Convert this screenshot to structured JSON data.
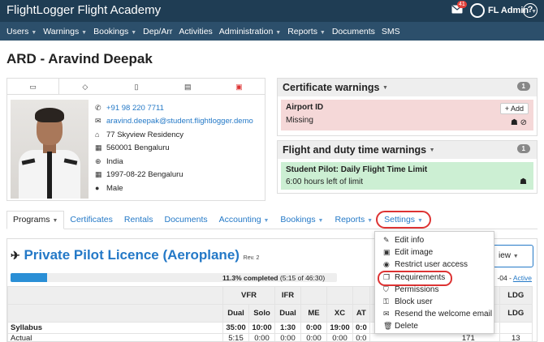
{
  "topbar": {
    "brand": "FlightLogger Flight Academy",
    "mail_count": "41",
    "user": "FL Admin",
    "help": "?"
  },
  "nav": [
    {
      "label": "Users",
      "caret": true
    },
    {
      "label": "Warnings",
      "caret": true
    },
    {
      "label": "Bookings",
      "caret": true
    },
    {
      "label": "Dep/Arr",
      "caret": false
    },
    {
      "label": "Activities",
      "caret": false
    },
    {
      "label": "Administration",
      "caret": true
    },
    {
      "label": "Reports",
      "caret": true
    },
    {
      "label": "Documents",
      "caret": false
    },
    {
      "label": "SMS",
      "caret": false
    }
  ],
  "page_title": "ARD - Aravind Deepak",
  "profile": {
    "phone": "+91 98 220 7711",
    "email": "aravind.deepak@student.flightlogger.demo",
    "address": "77 Skyview Residency",
    "postal": "560001 Bengaluru",
    "country": "India",
    "birth": "1997-08-22 Bengaluru",
    "gender": "Male"
  },
  "cert_warnings": {
    "title": "Certificate warnings",
    "count": "1",
    "item_title": "Airport ID",
    "item_status": "Missing",
    "add_label": "+ Add"
  },
  "duty_warnings": {
    "title": "Flight and duty time warnings",
    "count": "1",
    "item_title": "Student Pilot: Daily Flight Time Limit",
    "item_status": "6:00 hours left of limit"
  },
  "tabs": [
    "Programs",
    "Certificates",
    "Rentals",
    "Documents",
    "Accounting",
    "Bookings",
    "Reports",
    "Settings"
  ],
  "program": {
    "title": "Private Pilot Licence (Aeroplane)",
    "rev": "Rev. 2",
    "progress_pct": 11.3,
    "progress_label": "11.3% completed",
    "progress_detail": "(5:15 of 46:30)",
    "date_suffix": "-04 - ",
    "active_label": "Active",
    "view_label": "iew"
  },
  "table": {
    "h1": [
      "",
      "VFR",
      "",
      "IFR",
      "",
      "",
      "",
      "",
      "LDG"
    ],
    "h2": [
      "",
      "Dual",
      "Solo",
      "Dual",
      "ME",
      "XC",
      "AT",
      "",
      "LDG"
    ],
    "rows": [
      {
        "label": "Syllabus",
        "cells": [
          "35:00",
          "10:00",
          "1:30",
          "0:00",
          "19:00",
          "0:0",
          "",
          ""
        ]
      },
      {
        "label": "Actual",
        "cells": [
          "5:15",
          "0:00",
          "0:00",
          "0:00",
          "0:00",
          "0:0",
          "171",
          "13"
        ]
      }
    ]
  },
  "settings_menu": [
    {
      "icon": "pencil-icon",
      "glyph": "✎",
      "label": "Edit info"
    },
    {
      "icon": "image-icon",
      "glyph": "▣",
      "label": "Edit image"
    },
    {
      "icon": "eye-icon",
      "glyph": "◉",
      "label": "Restrict user access"
    },
    {
      "icon": "copy-icon",
      "glyph": "❐",
      "label": "Requirements"
    },
    {
      "icon": "shield-icon",
      "glyph": "⛉",
      "label": "Permissions"
    },
    {
      "icon": "user-lock-icon",
      "glyph": "⚿",
      "label": "Block user"
    },
    {
      "icon": "envelope-icon",
      "glyph": "✉",
      "label": "Resend the welcome email"
    },
    {
      "icon": "trash-icon",
      "glyph": "🗑",
      "label": "Delete"
    }
  ]
}
